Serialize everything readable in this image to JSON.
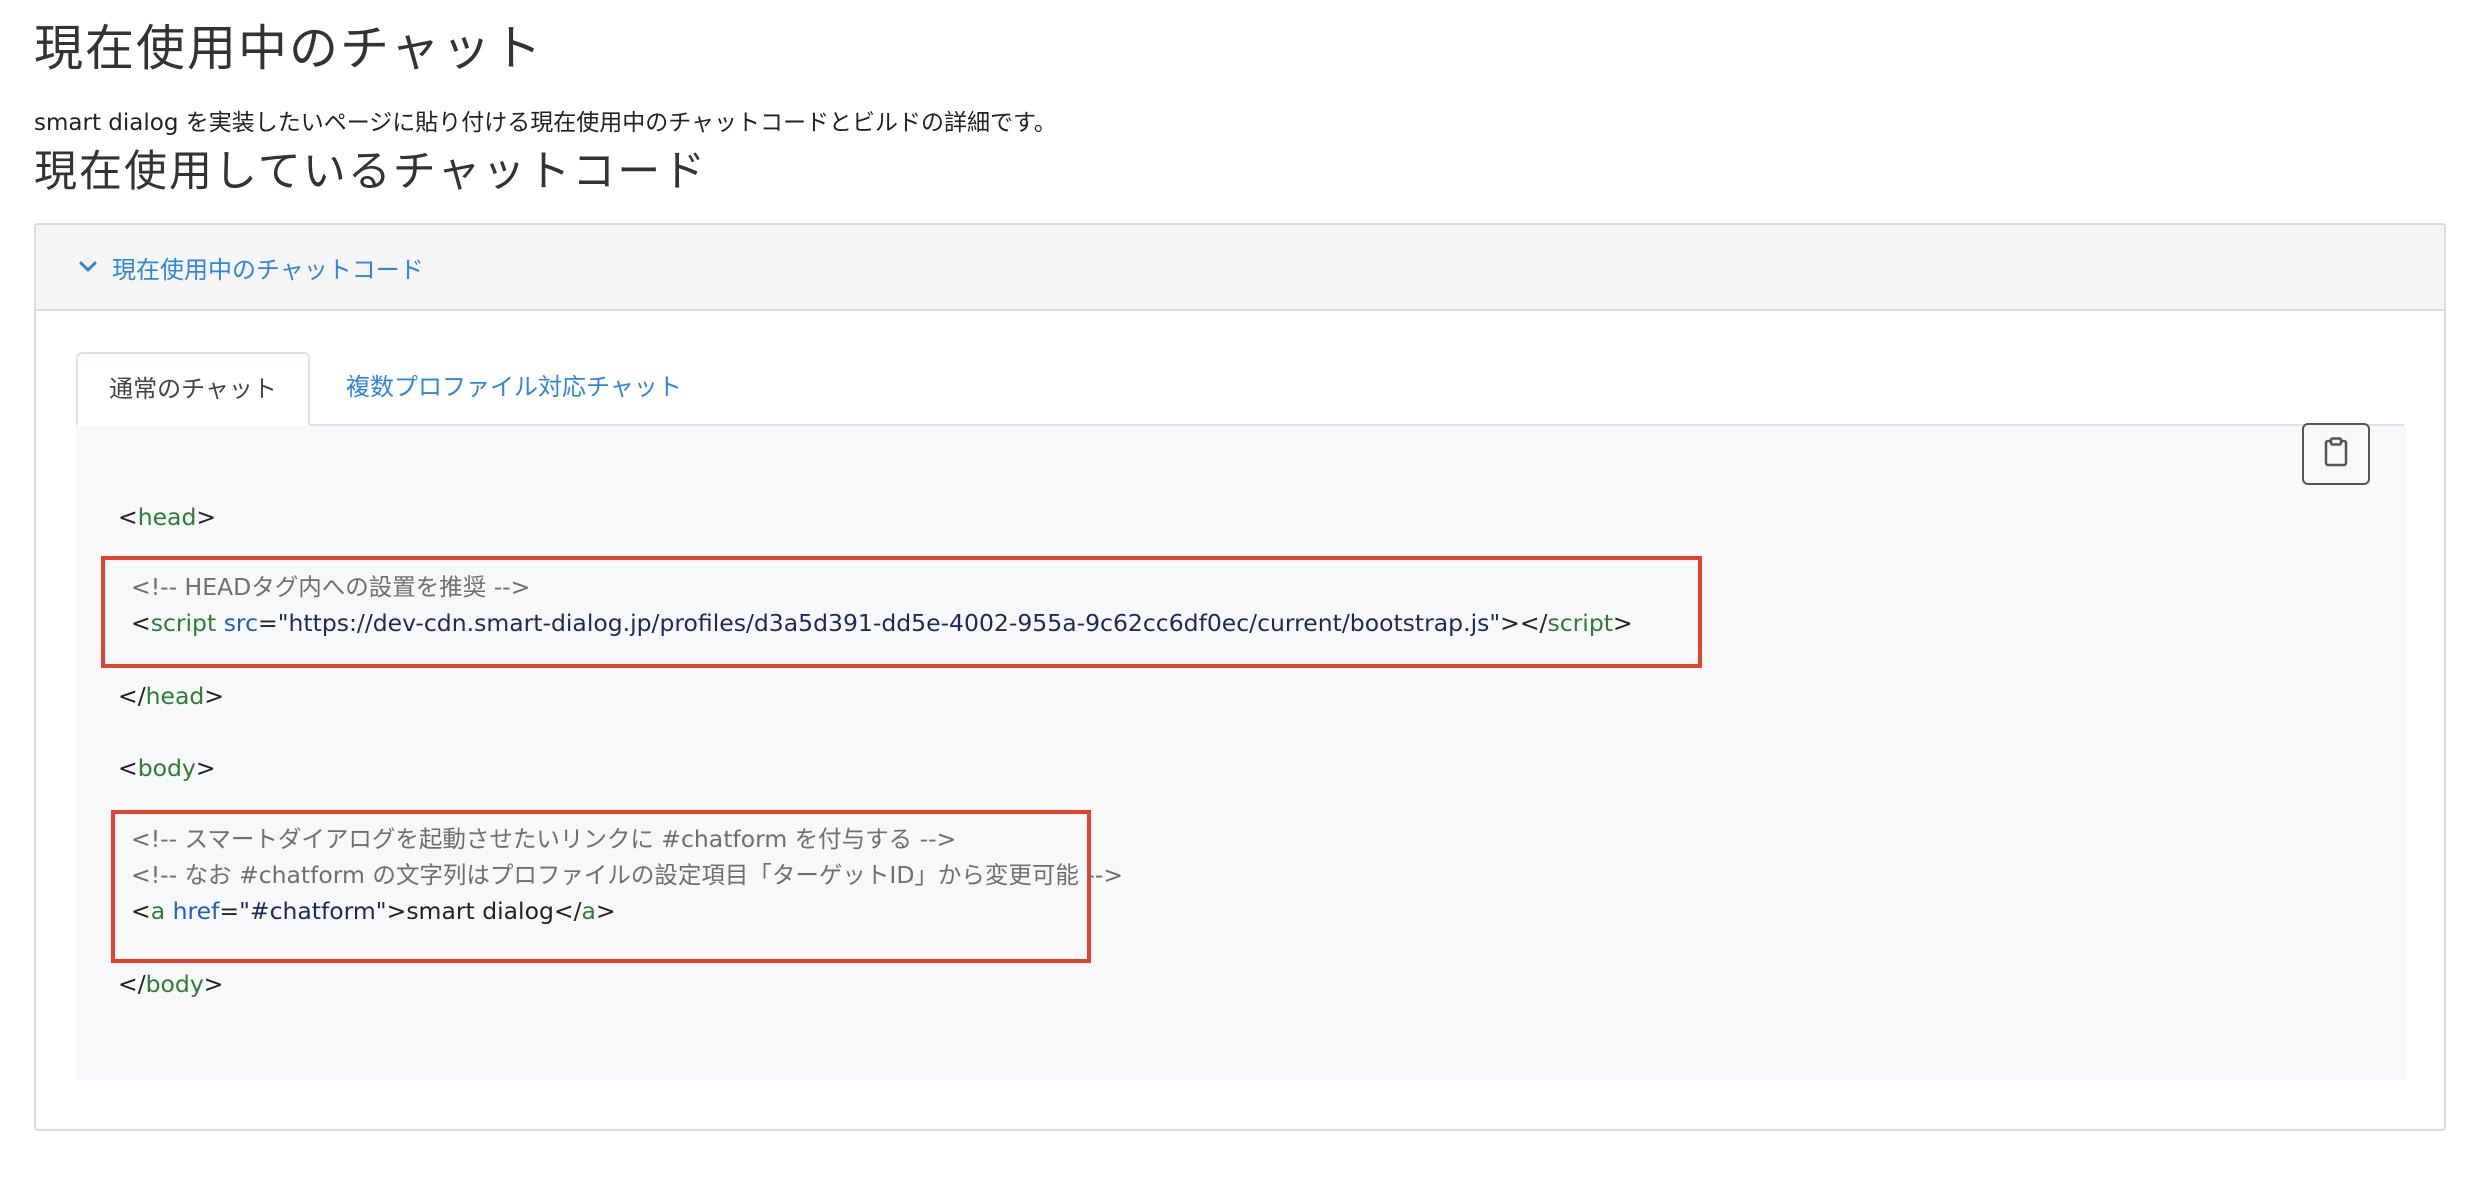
{
  "page": {
    "title": "現在使用中のチャット",
    "description": "smart dialog を実装したいページに貼り付ける現在使用中のチャットコードとビルドの詳細です。",
    "section_title": "現在使用しているチャットコード"
  },
  "panel": {
    "header_label": "現在使用中のチャットコード",
    "header_icon": "chevron-down-icon",
    "accent_color": "#2f86df"
  },
  "tabs": [
    {
      "label": "通常のチャット",
      "active": true
    },
    {
      "label": "複数プロファイル対応チャット",
      "active": false
    }
  ],
  "copy_button": {
    "icon": "clipboard-icon"
  },
  "code": {
    "head_tag": "head",
    "body_tag": "body",
    "script_tag": "script",
    "src_attr": "src",
    "a_tag": "a",
    "href_attr": "href",
    "head_comment": "<!-- HEADタグ内への設置を推奨 -->",
    "script_src": "\"https://dev-cdn.smart-dialog.jp/profiles/d3a5d391-dd5e-4002-955a-9c62cc6df0ec/current/bootstrap.js\"",
    "body_comment_1": "<!-- スマートダイアログを起動させたいリンクに #chatform を付与する -->",
    "body_comment_2": "<!-- なお #chatform の文字列はプロファイルの設定項目「ターゲットID」から変更可能 -->",
    "link_href": "\"#chatform\"",
    "link_text": "smart dialog"
  },
  "highlight_color": "#e0442e"
}
